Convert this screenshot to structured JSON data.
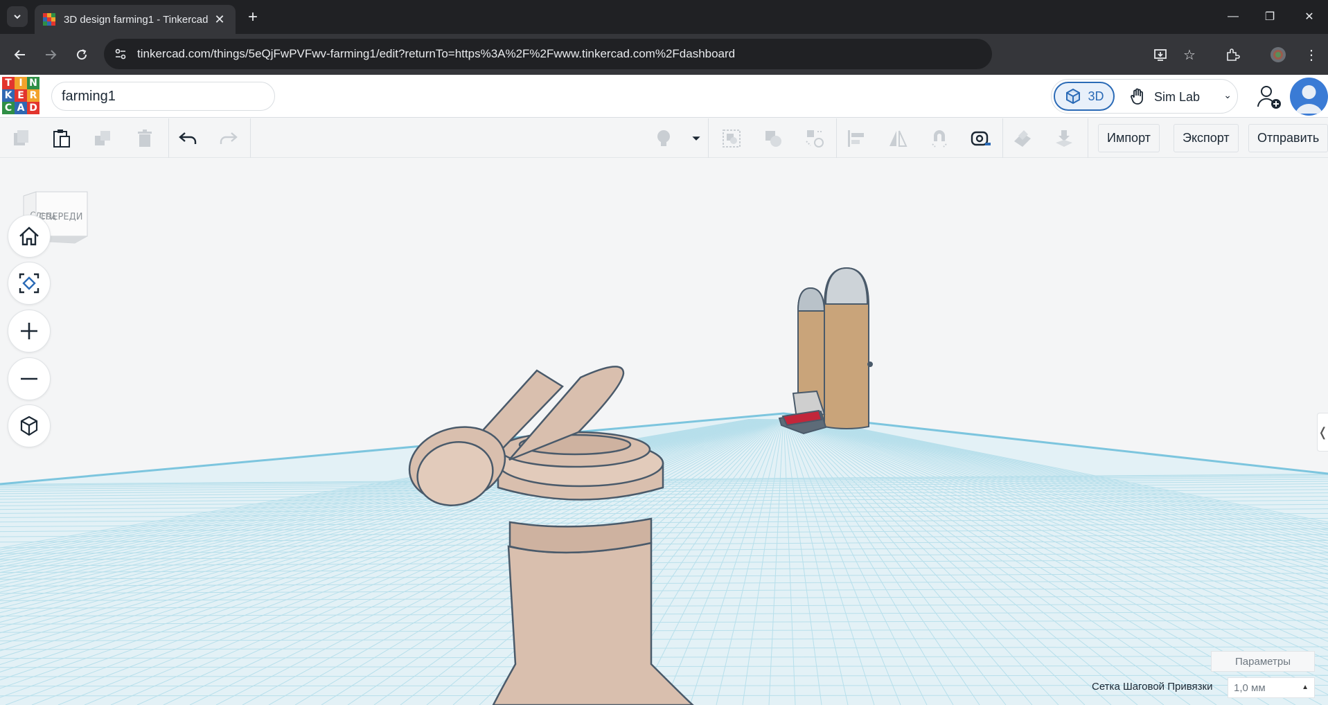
{
  "browser": {
    "tab_title": "3D design farming1 - Tinkercad",
    "url": "tinkercad.com/things/5eQjFwPVFwv-farming1/edit?returnTo=https%3A%2F%2Fwww.tinkercad.com%2Fdashboard"
  },
  "app": {
    "logo_letters": [
      "T",
      "I",
      "N",
      "K",
      "E",
      "R",
      "C",
      "A",
      "D"
    ],
    "logo_colors": [
      "#e2352e",
      "#f2a22b",
      "#2f8f46",
      "#3068b2",
      "#e2352e",
      "#f2a22b",
      "#2f8f46",
      "#3068b2",
      "#e2352e"
    ],
    "design_name": "farming1",
    "mode_3d_label": "3D",
    "mode_sim_label": "Sim Lab"
  },
  "actions": {
    "import_label": "Импорт",
    "export_label": "Экспорт",
    "send_label": "Отправить"
  },
  "viewcube": {
    "left_label": "СЛЕВА",
    "front_label": "СПЕРЕДИ"
  },
  "workplane": {
    "params_label": "Параметры",
    "snap_grid_label": "Сетка Шаговой Привязки",
    "snap_grid_value": "1,0 мм"
  },
  "colors": {
    "accent": "#2a6ab6",
    "object_fill": "#d9bfae",
    "silo_fill": "#c9a47a",
    "grid_line": "#a9d8e6",
    "outline": "#4a5a6a"
  }
}
